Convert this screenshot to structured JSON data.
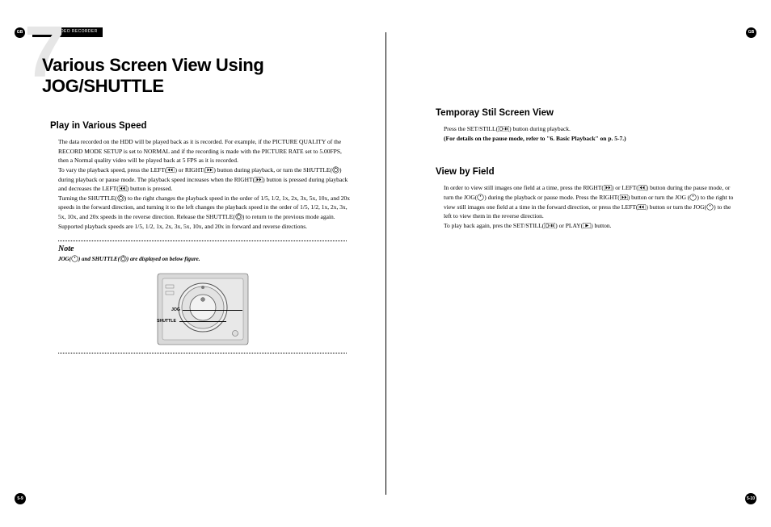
{
  "meta": {
    "header_label": "DIGITAL VIDEO RECORDER",
    "gb_badge": "GB",
    "page_left": "5-9",
    "page_right": "5-10",
    "chapter_number": "7",
    "chapter_title": "Various Screen View Using JOG/SHUTTLE"
  },
  "left": {
    "section_title": "Play in Various Speed",
    "para1": "The data recorded on the HDD will be played back as it is recorded. For example, if the PICTURE QUALITY of the RECORD MODE SETUP is set to NORMAL and if the recording is made with the PICTURE RATE set to 5.00FPS, then a Normal quality video will be played back at 5 FPS as it is recorded.",
    "para2a": "To vary the playback speed, press the LEFT(",
    "para2b": ") or RIGHT(",
    "para2c": ") button during playback, or turn the SHUTTLE(",
    "para2d": ") during playback or pause mode. The playback speed increases when the RIGHT(",
    "para2e": ") button is pressed during playback and decreases the LEFT(",
    "para2f": ") button is pressed.",
    "para3a": "Turning the SHUTTLE(",
    "para3b": ") to the right changes the playback speed in the order of 1/5, 1/2, 1x, 2x, 3x, 5x, 10x, and 20x speeds in the forward direction, and turning it to the left changes the playback speed in the order of 1/5, 1/2, 1x, 2x, 3x, 5x, 10x, and 20x speeds in the reverse direction. Release the SHUTTLE(",
    "para3c": ") to return to the previous mode again. Supported playback speeds are 1/5, 1/2, 1x, 2x, 3x, 5x, 10x, and 20x in forward and reverse directions.",
    "note_title": "Note",
    "note_a": "JOG(",
    "note_b": ") and SHUTTLE(",
    "note_c": ") are displayed on below figure.",
    "label_jog": "JOG",
    "label_shuttle": "SHUTTLE"
  },
  "right": {
    "sec1_title": "Temporay Stil Screen View",
    "sec1_a": "Press the SET/STILL(",
    "sec1_b": ") button during playback.",
    "sec1_bold": "(For details on the pause mode, refer to \"6. Basic Playback\" on p. 5-7.)",
    "sec2_title": "View by Field",
    "sec2_a": "In order to view still images one field at a time, press the RIGHT(",
    "sec2_b": ") or LEFT(",
    "sec2_c": ") button during the pause mode, or turn the JOG(",
    "sec2_d": ") during the playback or pause mode. Press the RIGHT(",
    "sec2_e": ") button or turn the JOG (",
    "sec2_f": ") to the right to view still images one field at a time in the forward direction, or press the LEFT(",
    "sec2_g": ") button or turn the JOG(",
    "sec2_h": ") to the left to view them in the reverse direction.",
    "sec2_i": "To play back again, pres the SET/STILL(",
    "sec2_j": ") or PLAY(",
    "sec2_k": ") button."
  }
}
